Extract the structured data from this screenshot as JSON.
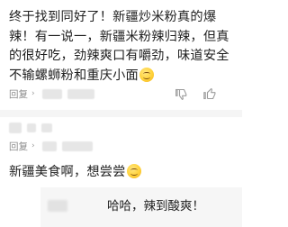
{
  "comments": [
    {
      "text": "终于找到同好了！新疆炒米粉真的爆辣！有一说一，新疆米粉辣归辣，但真的很好吃，劲辣爽口有嚼劲，味道安全不输螺蛳粉和重庆小面",
      "emoji": "laughing-face",
      "reply_label": "回复",
      "reply_chevron": "›"
    },
    {
      "text": "新疆美食啊，想尝尝",
      "emoji": "smirking-face",
      "reply_label": "回复",
      "reply_chevron": "›"
    }
  ],
  "nested_reply": {
    "text": "哈哈，辣到酸爽！"
  },
  "colors": {
    "text": "#1f1f1f",
    "meta": "#8c8c8c",
    "divider": "#f5f5f5",
    "reply_bg": "#f6f6f6"
  }
}
